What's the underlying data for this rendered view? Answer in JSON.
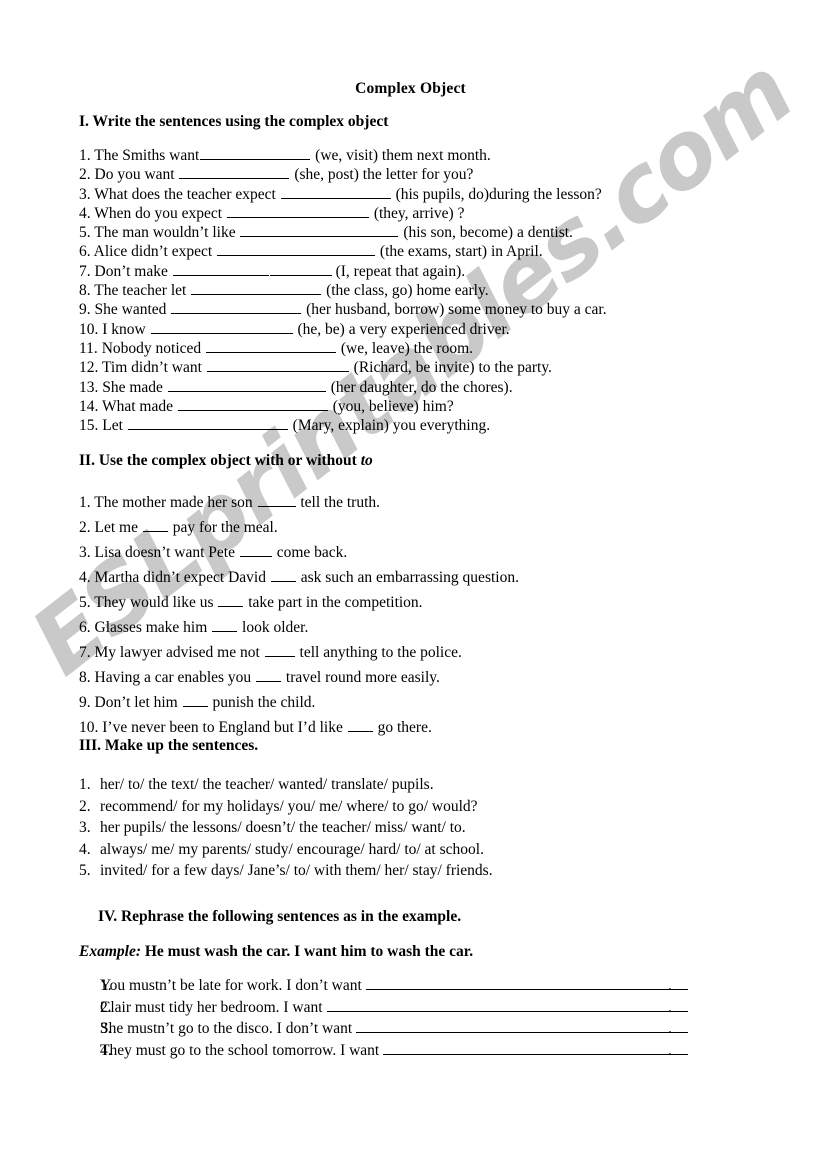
{
  "document": {
    "title": "Complex Object",
    "watermark": "ESLprintables.com",
    "watermark_color": "#c9c9c9"
  },
  "sections": [
    {
      "id": "I",
      "heading": "I. Write the sentences using the complex object",
      "items": [
        {
          "num": "1.",
          "pre": "The Smiths want",
          "gap": 0,
          "blank": 110,
          "post": "(we, visit) them next month."
        },
        {
          "num": "2.",
          "pre": "Do you want",
          "gap": 5,
          "blank": 110,
          "post": "(she, post) the letter for you?"
        },
        {
          "num": "3.",
          "pre": "What does the teacher expect",
          "gap": 5,
          "blank": 110,
          "post": "(his pupils, do)during the lesson?"
        },
        {
          "num": "4.",
          "pre": "When do you expect",
          "gap": 5,
          "blank": 142,
          "post": "(they, arrive) ?"
        },
        {
          "num": "5.",
          "pre": "The man wouldn’t like",
          "gap": 5,
          "blank": 158,
          "post": "(his son, become) a dentist."
        },
        {
          "num": "6.",
          "pre": "Alice didn’t expect",
          "gap": 5,
          "blank": 158,
          "post": "(the exams, start) in April."
        },
        {
          "num": "7.",
          "pre": "Don’t make",
          "gap": 8,
          "blank": 96,
          "blank_extra": 62,
          "post": "(I, repeat that again)."
        },
        {
          "num": "8.",
          "pre": "The teacher let",
          "gap": 5,
          "blank": 130,
          "post": "(the class, go) home early."
        },
        {
          "num": "9.",
          "pre": "She wanted",
          "gap": 5,
          "blank": 130,
          "post": "(her husband, borrow) some money to buy a car."
        },
        {
          "num": "10.",
          "pre": "I know",
          "gap": 5,
          "blank": 142,
          "post": "(he, be) a very experienced driver."
        },
        {
          "num": "11.",
          "pre": "Nobody noticed",
          "gap": 5,
          "blank": 130,
          "post": "(we, leave) the room."
        },
        {
          "num": "12.",
          "pre": "Tim didn’t want",
          "gap": 5,
          "blank": 142,
          "post": "(Richard, be invite) to the party."
        },
        {
          "num": "13.",
          "pre": "She made",
          "gap": 5,
          "blank": 158,
          "post": "(her daughter, do the chores)."
        },
        {
          "num": "14.",
          "pre": "What made",
          "gap": 5,
          "blank": 150,
          "post": "(you, believe) him?"
        },
        {
          "num": "15.",
          "pre": "Let",
          "gap": 5,
          "blank": 160,
          "post": "(Mary, explain) you everything."
        }
      ]
    },
    {
      "id": "II",
      "heading_pre": "II. Use the complex object with or without ",
      "heading_italic": "to",
      "items": [
        {
          "num": "1.",
          "pre": "The mother made her son",
          "blank": 38,
          "post": "tell the truth."
        },
        {
          "num": "2.",
          "pre": "Let me",
          "blank": 25,
          "post": "pay for the meal."
        },
        {
          "num": "3.",
          "pre": "Lisa doesn’t want Pete",
          "blank": 32,
          "post": "come back."
        },
        {
          "num": "4.",
          "pre": "Martha didn’t expect David",
          "blank": 25,
          "post": "ask such an embarrassing question."
        },
        {
          "num": "5.",
          "pre": "They would like us",
          "blank": 25,
          "post": "take part in the competition."
        },
        {
          "num": "6.",
          "pre": "Glasses make him",
          "blank": 25,
          "post": "look older."
        },
        {
          "num": "7.",
          "pre": "My lawyer advised me not",
          "blank": 30,
          "post": "tell anything to the police."
        },
        {
          "num": "8.",
          "pre": "Having a car enables you",
          "blank": 25,
          "post": "travel round more easily."
        },
        {
          "num": "9.",
          "pre": "Don’t let him",
          "blank": 25,
          "post": "punish the child."
        },
        {
          "num": "10.",
          "pre": "I’ve never been to England but I’d like",
          "blank": 25,
          "post": "go there."
        }
      ]
    },
    {
      "id": "III",
      "heading": "III. Make up the sentences.",
      "items": [
        {
          "num": "1.",
          "text": "her/ to/ the text/ the teacher/ wanted/ translate/ pupils."
        },
        {
          "num": "2.",
          "text": "recommend/ for my holidays/ you/ me/ where/ to go/ would?"
        },
        {
          "num": "3.",
          "text": "her pupils/ the lessons/ doesn’t/ the teacher/ miss/ want/ to."
        },
        {
          "num": "4.",
          "text": "always/ me/ my parents/ study/ encourage/ hard/ to/ at school."
        },
        {
          "num": "5.",
          "text": "invited/ for a few days/ Jane’s/ to/ with them/ her/ stay/ friends."
        }
      ]
    },
    {
      "id": "IV",
      "heading": "IV. Rephrase the following sentences as in the example.",
      "example_label": "Example:",
      "example_text": "He must wash the car. I want him to wash the car.",
      "items": [
        {
          "num": "1.",
          "text": "You mustn’t be late for work. I don’t want",
          "end": "."
        },
        {
          "num": "2.",
          "text": "Clair must tidy her bedroom.  I want",
          "end": "."
        },
        {
          "num": "3.",
          "text": "She mustn’t go to the disco. I don’t want",
          "end": "."
        },
        {
          "num": "4.",
          "text": "They must go to the school tomorrow. I want",
          "end": "."
        }
      ]
    }
  ]
}
